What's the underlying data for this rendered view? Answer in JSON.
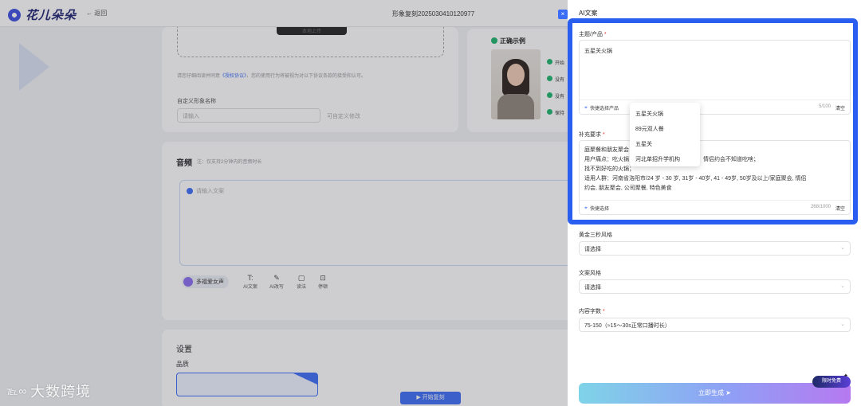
{
  "app": {
    "logo_text": "花儿朵朵",
    "back_label": "← 返回",
    "doc_title": "形象复刻2025030410120977",
    "close_glyph": "×"
  },
  "left": {
    "upload_button": "本地上传",
    "agreement_prefix": "请您仔细阅读并同意",
    "agreement_link": "《授权协议》",
    "agreement_suffix": "，您的使用行为将被视为对以下协议条款的接受和认可。",
    "name_label": "自定义形象名称",
    "name_placeholder": "请输入",
    "name_hint": "可自定义修改",
    "example_title": "正确示例",
    "example_checks": [
      "开始",
      "没有",
      "没有",
      "保持"
    ],
    "audio_title": "音频",
    "audio_note": "注：仅支持2分钟内的音频时长",
    "audio_placeholder": "请输入文案",
    "voice_chip": "多福爱女声",
    "tools": [
      {
        "icon": "T:",
        "label": "AI文案"
      },
      {
        "icon": "✎",
        "label": "AI改写"
      },
      {
        "icon": "▢",
        "label": "读法"
      },
      {
        "icon": "⊡",
        "label": "停顿"
      }
    ],
    "settings_title": "设置",
    "quality_label": "品质",
    "start_button": "▶ 开始复刻",
    "watermark": "大数跨境",
    "watermark_logo": "℡∞"
  },
  "drawer": {
    "title": "AI文案",
    "topic_label": "主题/产品",
    "topic_value": "五星关火锅",
    "topic_quick": "快捷选择产品",
    "topic_counter": "5/100",
    "clear_label": "清空",
    "extra_label": "补充要求",
    "extra_lines": [
      "庭聚餐和朋友聚会",
      "用户痛点：吃火锅                           去哪；家庭聚餐不知道吃啥；情侣约会不知道吃啥；",
      "找不到好吃的火锅；",
      "适用人群：河南省洛阳市/24 岁 - 30 岁, 31岁 - 40岁, 41 - 49岁, 50岁及以上/家庭聚会, 情侣",
      "约会, 朋友聚会, 公司聚餐, 特色美食"
    ],
    "extra_quick": "快捷选择",
    "extra_counter": "268/1000",
    "dropdown_items": [
      "五星关火锅",
      "89元双人餐",
      "五星关",
      "河北单招升学机构"
    ],
    "golden_label": "黄金三秒风格",
    "golden_value": "请选择",
    "style_label": "文案风格",
    "style_value": "请选择",
    "count_label": "内容字数",
    "count_value": "75-150（≈15～30s正常口播时长）",
    "generate_button": "立即生成 ➤",
    "free_badge": "限时免费",
    "required_mark": "*"
  }
}
